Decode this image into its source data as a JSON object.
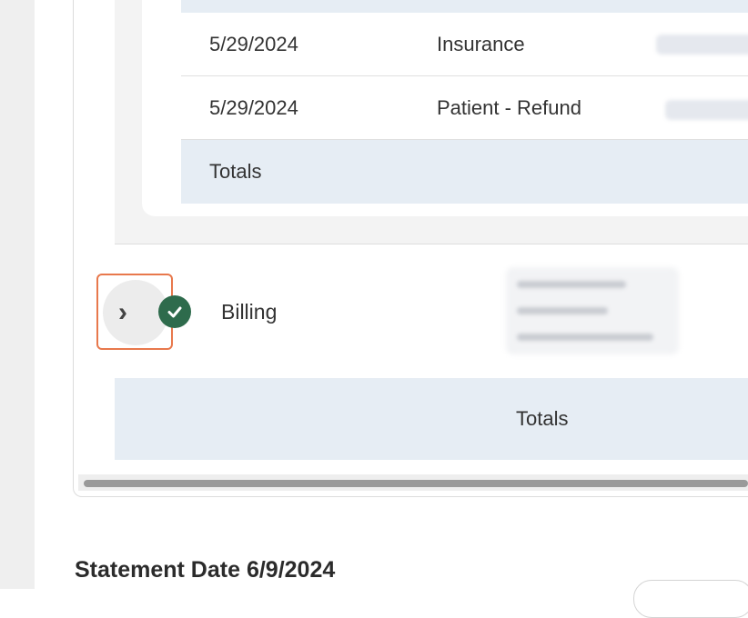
{
  "history_table": {
    "rows": [
      {
        "date": "5/29/2024",
        "type": "Insurance"
      },
      {
        "date": "5/29/2024",
        "type": "Patient - Refund"
      }
    ],
    "totals_label": "Totals"
  },
  "billing_section": {
    "expand_icon": "chevron-right",
    "status_icon": "check-circle",
    "label": "Billing",
    "totals_label": "Totals"
  },
  "statement": {
    "heading": "Statement Date 6/9/2024"
  },
  "colors": {
    "status_green": "#2e6b4c",
    "highlight_orange": "#e8784c",
    "totals_band": "#e6edf4"
  }
}
